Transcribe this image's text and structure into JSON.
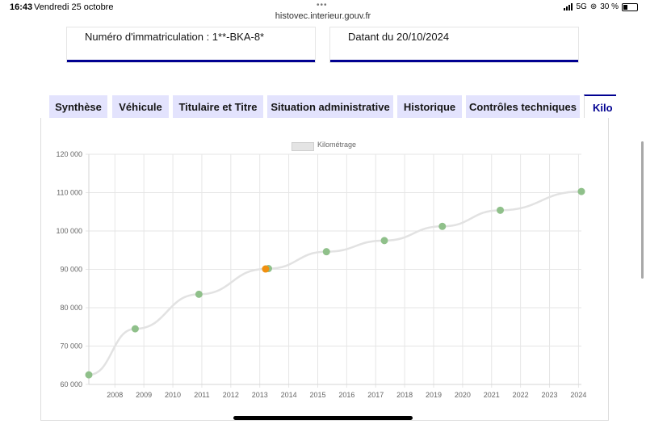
{
  "status_bar": {
    "time": "16:43",
    "date": "Vendredi 25 octobre",
    "url": "histovec.interieur.gouv.fr",
    "network": "5G",
    "battery": "30 %"
  },
  "cards": {
    "registration": "Numéro d'immatriculation : 1**-BKA-8*",
    "dated": "Datant du 20/10/2024"
  },
  "tabs": [
    {
      "label": "Synthèse"
    },
    {
      "label": "Véhicule"
    },
    {
      "label": "Titulaire et Titre"
    },
    {
      "label": "Situation administrative"
    },
    {
      "label": "Historique"
    },
    {
      "label": "Contrôles techniques"
    },
    {
      "label": "Kilo"
    }
  ],
  "colors": {
    "accent": "#000091",
    "tab_bg": "#e3e3fd",
    "line": "#e2e2e2",
    "point": "#8fc08a",
    "highlight_point": "#f0900f"
  },
  "chart_data": {
    "type": "line",
    "legend": "Kilométrage",
    "legend_position": "top-center",
    "grid": true,
    "ylim": [
      60000,
      120000
    ],
    "xlim": [
      2007.6,
      2024.6
    ],
    "y_ticks": [
      60000,
      70000,
      80000,
      90000,
      100000,
      110000,
      120000
    ],
    "y_tick_labels": [
      "60 000",
      "70 000",
      "80 000",
      "90 000",
      "100 000",
      "110 000",
      "120 000"
    ],
    "x_ticks": [
      "2008",
      "2009",
      "2010",
      "2011",
      "2012",
      "2013",
      "2014",
      "2015",
      "2016",
      "2017",
      "2018",
      "2019",
      "2020",
      "2021",
      "2022",
      "2023",
      "2024"
    ],
    "series": [
      {
        "name": "Kilométrage",
        "points": [
          {
            "x": 2007.6,
            "y": 62500
          },
          {
            "x": 2009.2,
            "y": 74500
          },
          {
            "x": 2011.4,
            "y": 83500
          },
          {
            "x": 2013.7,
            "y": 90100,
            "highlight": true
          },
          {
            "x": 2013.8,
            "y": 90200
          },
          {
            "x": 2015.8,
            "y": 94600
          },
          {
            "x": 2017.8,
            "y": 97500
          },
          {
            "x": 2019.8,
            "y": 101200
          },
          {
            "x": 2021.8,
            "y": 105400
          },
          {
            "x": 2024.6,
            "y": 110300
          }
        ]
      }
    ]
  }
}
